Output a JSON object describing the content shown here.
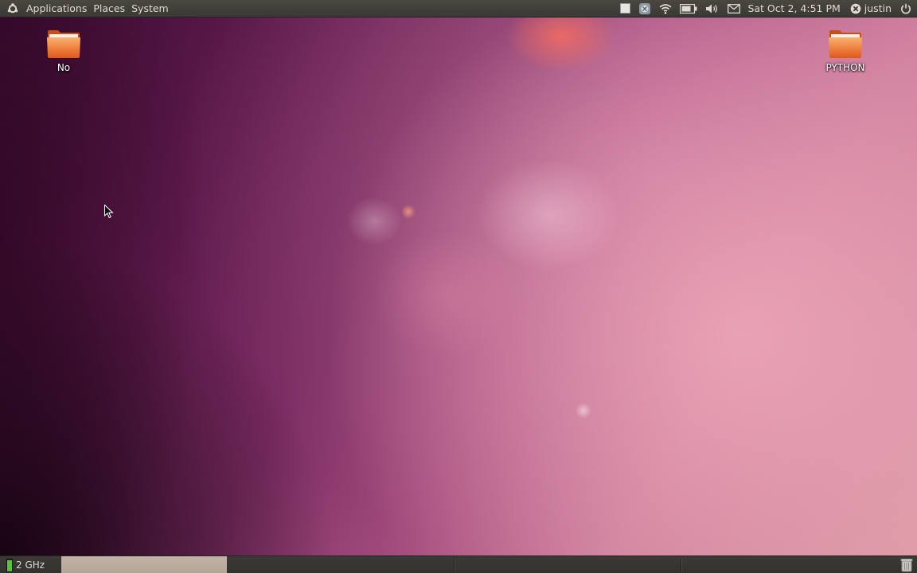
{
  "top_panel": {
    "menus": {
      "applications": "Applications",
      "places": "Places",
      "system": "System"
    },
    "clock": "Sat Oct  2,  4:51 PM",
    "user": "justin",
    "tray_icons": [
      "window-icon",
      "network-manager-icon",
      "wifi-icon",
      "battery-icon",
      "volume-icon",
      "mail-icon"
    ]
  },
  "desktop": {
    "icons": [
      {
        "label": "No",
        "icon": "folder-icon"
      },
      {
        "label": "PYTHON",
        "icon": "folder-icon"
      }
    ]
  },
  "bottom_panel": {
    "cpu_frequency": "2 GHz",
    "cpu_level_percent": 90
  },
  "colors": {
    "panel": "#3c3a36",
    "panel_text": "#dfdbd2",
    "task_button": "#b8a99c",
    "folder_orange": "#f07a2a"
  }
}
